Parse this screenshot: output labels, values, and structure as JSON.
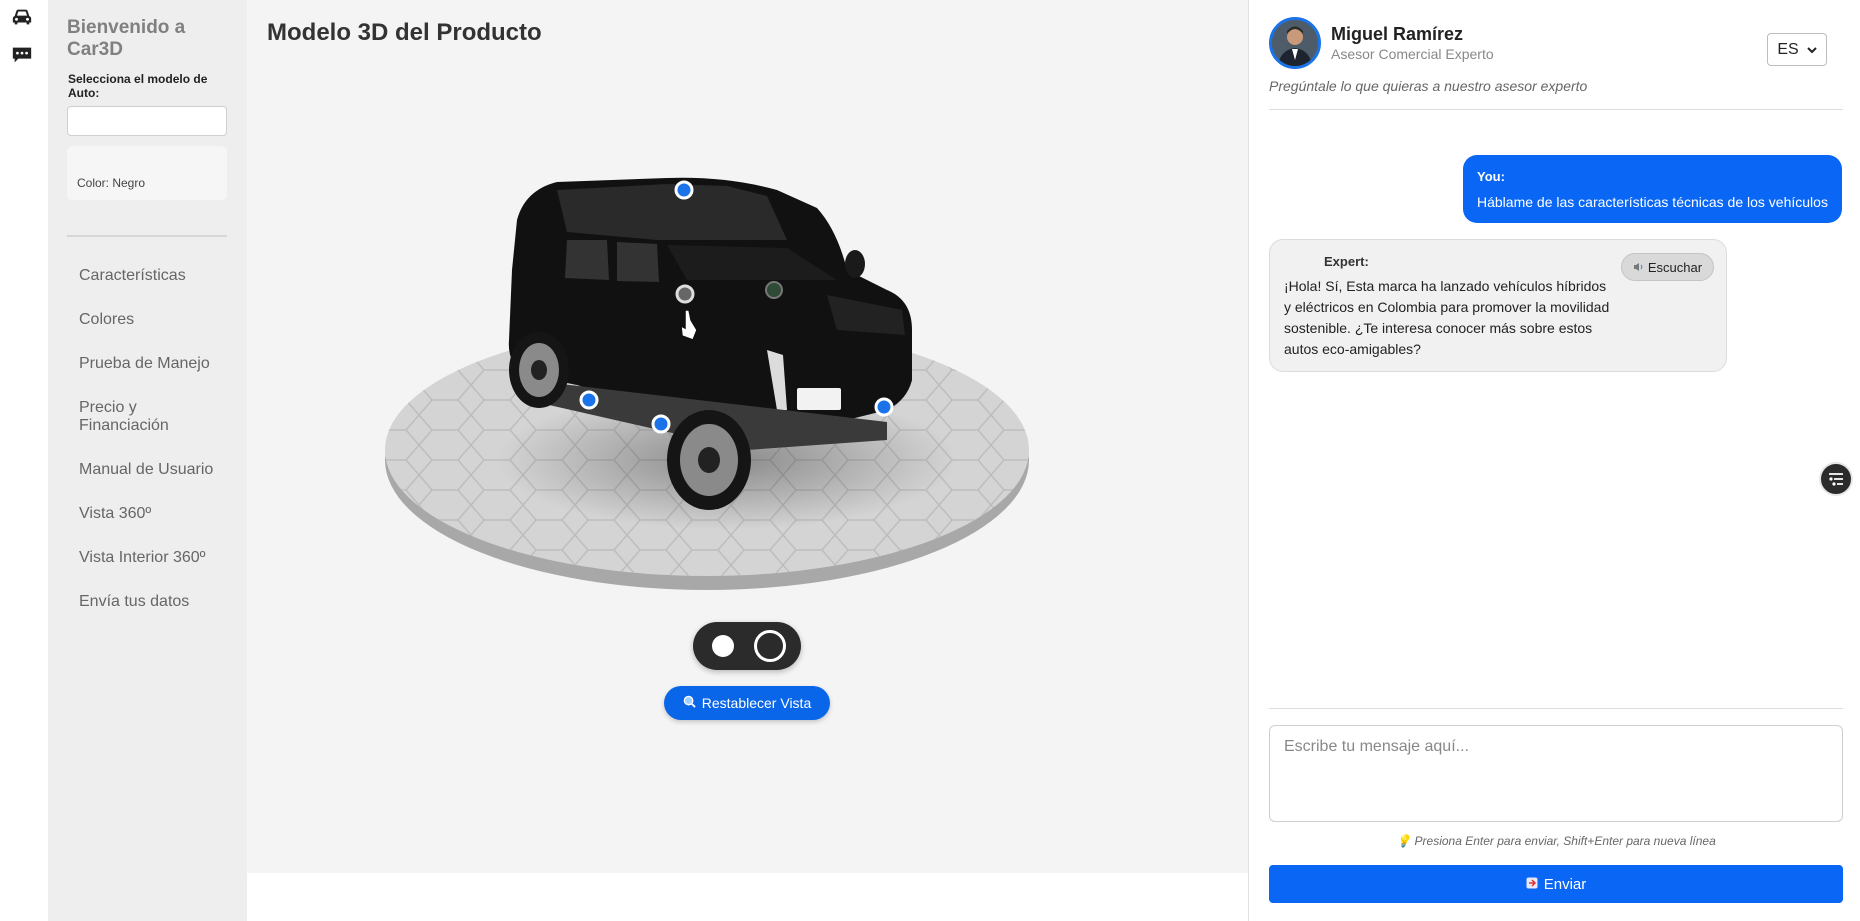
{
  "rail": {
    "icons": [
      "car-icon",
      "chat-icon"
    ]
  },
  "sidebar": {
    "welcome": "Bienvenido a Car3D",
    "select_label": "Selecciona el modelo de Auto:",
    "model_input_value": "",
    "color_label": "Color: Negro",
    "nav": [
      "Características",
      "Colores",
      "Prueba de Manejo",
      "Precio y Financiación",
      "Manual de Usuario",
      "Vista 360º",
      "Vista Interior 360º",
      "Envía tus datos"
    ]
  },
  "viewer": {
    "title": "Modelo 3D del Producto",
    "reset_label": "Restablecer Vista",
    "theme_toggle": [
      "light",
      "dark"
    ]
  },
  "chat": {
    "advisor_name": "Miguel Ramírez",
    "advisor_role": "Asesor Comercial Experto",
    "language": "ES",
    "ask_hint": "Pregúntale lo que quieras a nuestro asesor experto",
    "messages": [
      {
        "sender": "You:",
        "text": "Háblame de las características técnicas de los vehículos"
      },
      {
        "sender": "Expert:",
        "text": "¡Hola! Sí, Esta marca ha lanzado vehículos híbridos y eléctricos en Colombia para promover la movilidad sostenible. ¿Te interesa conocer más sobre estos autos eco-amigables?",
        "listen_label": "Escuchar"
      }
    ],
    "input_placeholder": "Escribe tu mensaje aquí...",
    "enter_hint": "Presiona Enter para enviar, Shift+Enter para nueva línea",
    "send_label": "Enviar"
  },
  "colors": {
    "accent": "#0a66f5",
    "sidebar_bg": "#eeeeee",
    "viewer_bg": "#f4f4f4",
    "car": "#111111"
  }
}
